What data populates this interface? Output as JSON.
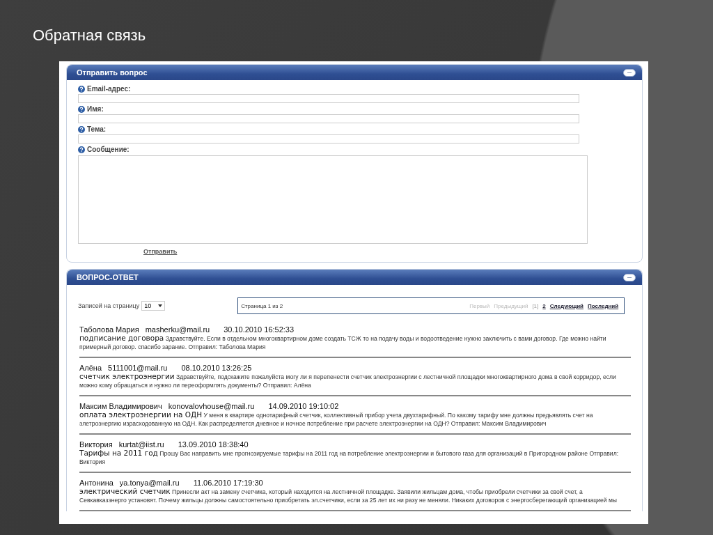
{
  "slide": {
    "title": "Обратная связь"
  },
  "question_panel": {
    "title": "Отправить вопрос",
    "fields": [
      {
        "label": "Email-адрес:",
        "kind": "line"
      },
      {
        "label": "Имя:",
        "kind": "line"
      },
      {
        "label": "Тема:",
        "kind": "line"
      },
      {
        "label": "Сообщение:",
        "kind": "area"
      }
    ],
    "submit": "Отправить"
  },
  "answers_panel": {
    "title": "ВОПРОС-ОТВЕТ",
    "per_page_label": "Записей на страницу",
    "per_page_value": "10",
    "page_info": "Страница 1 из 2",
    "pager": [
      {
        "label": "Первый",
        "kind": "disabled"
      },
      {
        "label": "Предыдущий",
        "kind": "disabled"
      },
      {
        "label": "[1]",
        "kind": "current"
      },
      {
        "label": "2",
        "kind": "link"
      },
      {
        "label": "Следующий",
        "kind": "link"
      },
      {
        "label": "Последний",
        "kind": "link"
      }
    ],
    "entries": [
      {
        "name": "Таболова Мария",
        "email": "masherku@mail.ru",
        "date": "30.10.2010 16:52:33",
        "subject": "подписание договора",
        "text": "Здравствуйте. Если в отдельном многоквартирном доме создать ТСЖ то на подачу воды и водоотведение нужно заключить с вами договор. Где можно найти примерный договор. спасибо зарание. Отправил: Таболова Мария"
      },
      {
        "name": "Алёна",
        "email": "5111001@mail.ru",
        "date": "08.10.2010 13:26:25",
        "subject": "счетчик электроэнергии",
        "text": "Здравствуйте, подскажите пожалуйста могу ли я перепенести счетчик электроэнергии с лестничной площадки многоквартирного дома в свой корридор, если можно кому обращаться и нужно ли переоформлять документы? Отправил: Алёна"
      },
      {
        "name": "Максим Владимирович",
        "email": "konovalovhouse@mail.ru",
        "date": "14.09.2010 19:10:02",
        "subject": "оплата электроэнергии на ОДН",
        "text": "У меня в квартире однотарифный счетчик, коллективный прибор учета двухтарифный. По какому тарифу мне должны предьявлять счет на элетроэнергию израсходованную на ОДН. Как распределяется дневное и ночное потребление при расчете электроэнергии на ОДН? Отправил: Максим Владимирович"
      },
      {
        "name": "Виктория",
        "email": "kurtat@iist.ru",
        "date": "13.09.2010 18:38:40",
        "subject": "Тарифы на 2011 год",
        "text": "Прошу Вас направить мне прогнозируемые тарифы на 2011 год на потребление электроэнергии и бытового газа для организаций в Пригородном районе Отправил: Виктория"
      },
      {
        "name": "Антонина",
        "email": "ya.tonya@mail.ru",
        "date": "11.06.2010 17:19:30",
        "subject": "электрический счетчик",
        "text": "Принесли акт на замену счетчика, который находится на лестничной площадке. Заявили жильцам дома, чтобы приобрели счетчики за свой счет, а Севкавказэнерго установят. Почему жильцы должны самостоятельно приобретать эл.счетчики, если за 25 лет их ни разу не меняли. Никаких договоров с энергосберегающий организацией мы"
      }
    ]
  }
}
